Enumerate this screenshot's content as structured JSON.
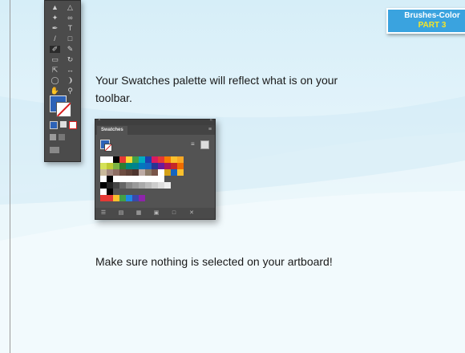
{
  "badge": {
    "line1": "Brushes-Color",
    "line2": "PART 3"
  },
  "instructions": {
    "line1": "Your Swatches palette will reflect what is on your toolbar.",
    "line2": "Make sure nothing is selected on your artboard!"
  },
  "toolbar": {
    "fill_color": "#2d62b7",
    "stroke": "none",
    "tool_icons": [
      "selection-icon",
      "direct-selection-icon",
      "magic-wand-icon",
      "lasso-icon",
      "pen-icon",
      "type-icon",
      "line-icon",
      "rectangle-icon",
      "paintbrush-icon",
      "pencil-icon",
      "eraser-icon",
      "rotate-icon",
      "scale-icon",
      "width-icon",
      "shape-builder-icon",
      "perspective-icon",
      "mesh-icon",
      "gradient-icon",
      "eyedropper-icon",
      "blend-icon",
      "symbol-sprayer-icon",
      "column-graph-icon",
      "artboard-icon",
      "slice-icon",
      "hand-icon",
      "zoom-icon"
    ]
  },
  "swatches_panel": {
    "tab_label": "Swatches",
    "fill_color": "#2d62b7",
    "stroke": "none",
    "swatch_rows": [
      [
        "#ffffff",
        "#ffffff",
        "#000000",
        "#e53935",
        "#fdd835",
        "#43a047",
        "#00acc1",
        "#1e40af",
        "#d81b60",
        "#e53935",
        "#f57c00",
        "#fbc02d",
        "#f9a825"
      ],
      [
        "#d4e157",
        "#c0ca33",
        "#7cb342",
        "#2e7d32",
        "#00897b",
        "#00838f",
        "#0277bd",
        "#1565c0",
        "#283593",
        "#6a1b9a",
        "#ad1457",
        "#c62828",
        "#ef6c00"
      ],
      [
        "#c8b89a",
        "#a1887f",
        "#8d6e63",
        "#6d4c41",
        "#5d4037",
        "#4e342e",
        "#bcaaa4",
        "#8d7b68",
        "#795548",
        "#ffffff",
        "#d4a017",
        "#1565c0",
        "#fbc02d"
      ],
      [
        "#ffffff",
        "#000000",
        "#ffffff",
        "#ffffff",
        "#ffffff",
        "#ffffff",
        "#ffffff",
        "#ffffff",
        "#ffffff",
        "#ffffff"
      ],
      [
        "#000000",
        "#222222",
        "#444444",
        "#666666",
        "#888888",
        "#999999",
        "#aaaaaa",
        "#bbbbbb",
        "#cccccc",
        "#dddddd",
        "#eeeeee"
      ],
      [
        "#ffffff",
        "#000000",
        "#535353",
        "#535353",
        "#535353",
        "#535353",
        "#535353",
        "#535353",
        "#535353"
      ],
      [
        "#e53935",
        "#e53935",
        "#fbc02d",
        "#43a047",
        "#1e88e5",
        "#3949ab",
        "#8e24aa"
      ]
    ],
    "bottom_icons": [
      "swatch-libraries-icon",
      "show-kinds-icon",
      "swatch-options-icon",
      "new-color-group-icon",
      "new-swatch-icon",
      "delete-swatch-icon"
    ]
  }
}
